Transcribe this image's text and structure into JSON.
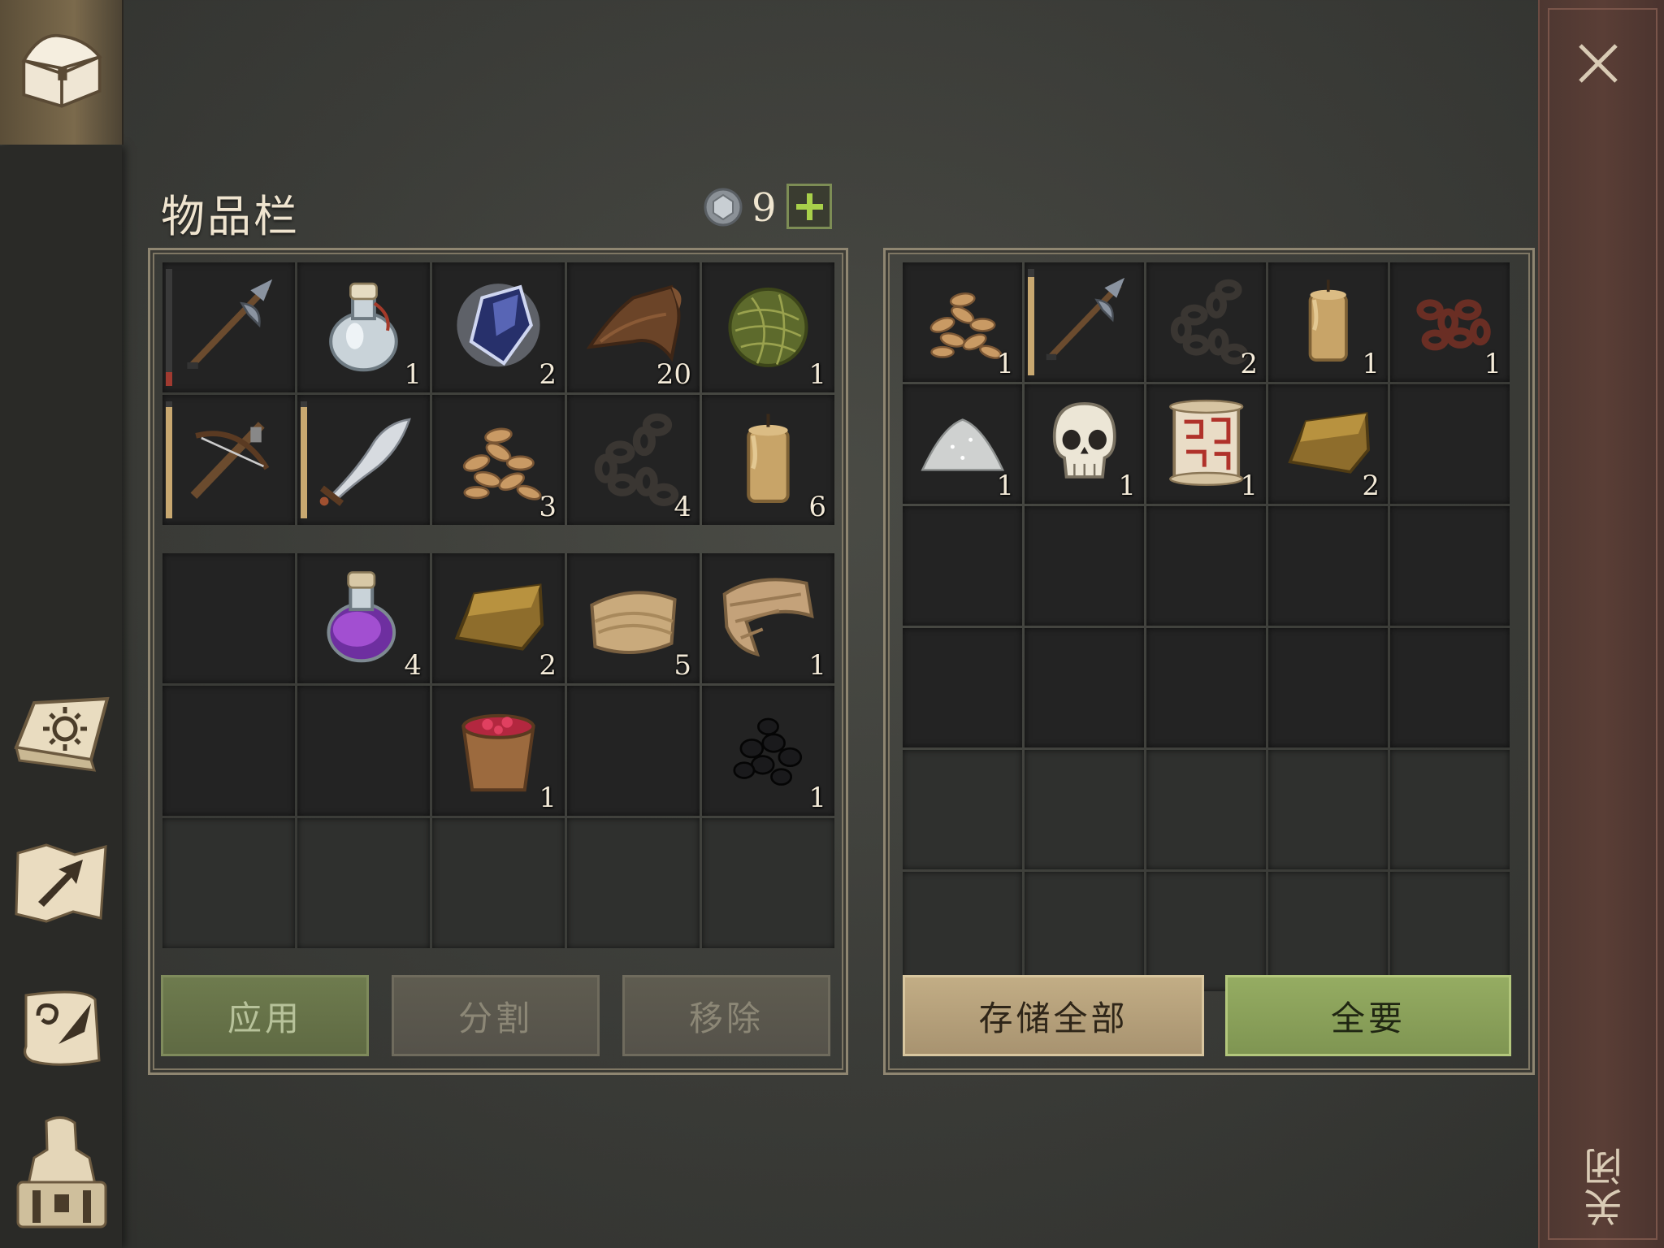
{
  "inventory": {
    "title": "物品栏",
    "currency_count": "9",
    "currency_icon": "silver-coin-icon",
    "add_icon": "plus-icon",
    "rows": [
      [
        {
          "icon": "halberd-icon",
          "qty": "",
          "durability": 0.12,
          "dur_color": "#a03a30"
        },
        {
          "icon": "water-flask-icon",
          "qty": "1"
        },
        {
          "icon": "blue-crystal-icon",
          "qty": "2"
        },
        {
          "icon": "leather-icon",
          "qty": "20"
        },
        {
          "icon": "plant-fiber-ball-icon",
          "qty": "1"
        }
      ],
      [
        {
          "icon": "crossbow-icon",
          "qty": "",
          "durability": 0.95,
          "dur_color": "#c8a870"
        },
        {
          "icon": "scimitar-icon",
          "qty": "",
          "durability": 0.95,
          "dur_color": "#c8a870"
        },
        {
          "icon": "grain-seeds-icon",
          "qty": "3"
        },
        {
          "icon": "chain-icon",
          "qty": "4"
        },
        {
          "icon": "candle-icon",
          "qty": "6"
        }
      ],
      [
        {
          "icon": "",
          "qty": ""
        },
        {
          "icon": "purple-potion-icon",
          "qty": "4"
        },
        {
          "icon": "gold-ingot-icon",
          "qty": "2"
        },
        {
          "icon": "cloth-icon",
          "qty": "5"
        },
        {
          "icon": "rag-icon",
          "qty": "1"
        }
      ],
      [
        {
          "icon": "",
          "qty": ""
        },
        {
          "icon": "",
          "qty": ""
        },
        {
          "icon": "berry-bucket-icon",
          "qty": "1"
        },
        {
          "icon": "",
          "qty": ""
        },
        {
          "icon": "coal-icon",
          "qty": "1"
        }
      ]
    ],
    "buttons": {
      "apply": "应用",
      "split": "分割",
      "remove": "移除"
    }
  },
  "storage": {
    "rows": [
      [
        {
          "icon": "grain-seeds-icon",
          "qty": "1"
        },
        {
          "icon": "halberd-icon",
          "qty": "",
          "durability": 0.92,
          "dur_color": "#c8a870"
        },
        {
          "icon": "chain-icon",
          "qty": "2"
        },
        {
          "icon": "candle-icon",
          "qty": "1"
        },
        {
          "icon": "rusty-chain-icon",
          "qty": "1"
        }
      ],
      [
        {
          "icon": "salt-pile-icon",
          "qty": "1"
        },
        {
          "icon": "skull-icon",
          "qty": "1"
        },
        {
          "icon": "map-scroll-icon",
          "qty": "1"
        },
        {
          "icon": "gold-ingot-icon",
          "qty": "2"
        },
        {
          "icon": "",
          "qty": ""
        }
      ]
    ],
    "buttons": {
      "store_all": "存储全部",
      "take_all": "全要"
    }
  },
  "sidebar": {
    "items": [
      {
        "icon": "chest-icon"
      },
      {
        "icon": "sun-book-icon"
      },
      {
        "icon": "map-arrow-icon"
      },
      {
        "icon": "quest-scroll-icon"
      },
      {
        "icon": "character-backpack-icon"
      }
    ]
  },
  "close": {
    "label": "关闭",
    "icon": "close-icon"
  },
  "colors": {
    "accent_green": "#7f9552",
    "panel_border": "#8f8671",
    "close_strip": "#5a3e36"
  }
}
